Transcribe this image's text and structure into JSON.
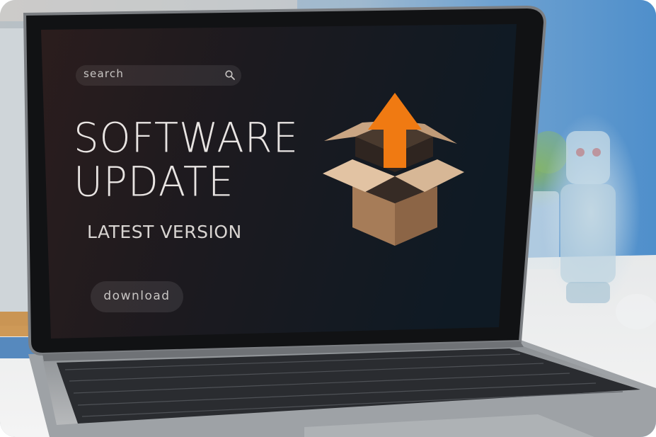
{
  "screen": {
    "search": {
      "placeholder": "search",
      "icon": "search-icon"
    },
    "title_line_1": "SOFTWARE",
    "title_line_2": "UPDATE",
    "subtitle": "LATEST VERSION",
    "download_label": "download",
    "graphic_icon": "open-box-upload-arrow-icon"
  },
  "colors": {
    "screen_background": "#1f1a1c",
    "arrow": "#f07a12",
    "box_light": "#d7b796",
    "box_dark": "#9c7552",
    "text": "#e8e4e2",
    "wall_blue": "#5f98cd"
  }
}
